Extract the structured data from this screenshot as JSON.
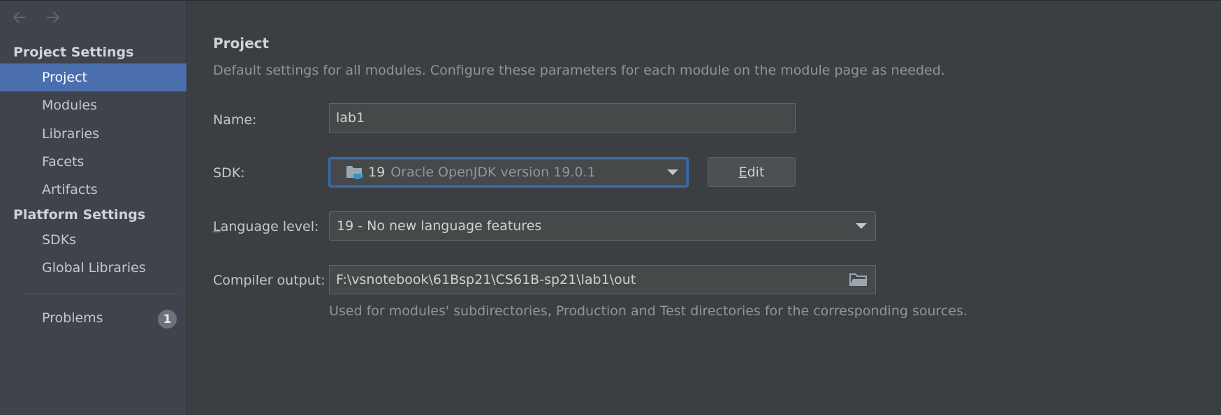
{
  "nav": {
    "back_icon": "arrow-left-icon",
    "forward_icon": "arrow-right-icon"
  },
  "sidebar": {
    "project_settings_header": "Project Settings",
    "project_items": [
      {
        "label": "Project",
        "selected": true
      },
      {
        "label": "Modules"
      },
      {
        "label": "Libraries"
      },
      {
        "label": "Facets"
      },
      {
        "label": "Artifacts"
      }
    ],
    "platform_settings_header": "Platform Settings",
    "platform_items": [
      {
        "label": "SDKs"
      },
      {
        "label": "Global Libraries"
      }
    ],
    "problems": {
      "label": "Problems",
      "count": "1"
    }
  },
  "main": {
    "title": "Project",
    "description": "Default settings for all modules. Configure these parameters for each module on the module page as needed.",
    "name": {
      "label": "Name:",
      "value": "lab1"
    },
    "sdk": {
      "label": "SDK:",
      "version": "19",
      "description": "Oracle OpenJDK version 19.0.1",
      "edit_label_mnemonic": "E",
      "edit_label_rest": "dit"
    },
    "language_level": {
      "label_mnemonic": "L",
      "label_rest": "anguage level:",
      "value": "19 - No new language features"
    },
    "compiler_output": {
      "label": "Compiler output:",
      "value": "F:\\vsnotebook\\61Bsp21\\CS61B-sp21\\lab1\\out",
      "hint": "Used for modules' subdirectories, Production and Test directories for the corresponding sources."
    }
  },
  "colors": {
    "selection": "#4b6eaf",
    "focus_border": "#3d6aa3",
    "background": "#3c3f41",
    "sidebar_background": "#3e434c"
  }
}
